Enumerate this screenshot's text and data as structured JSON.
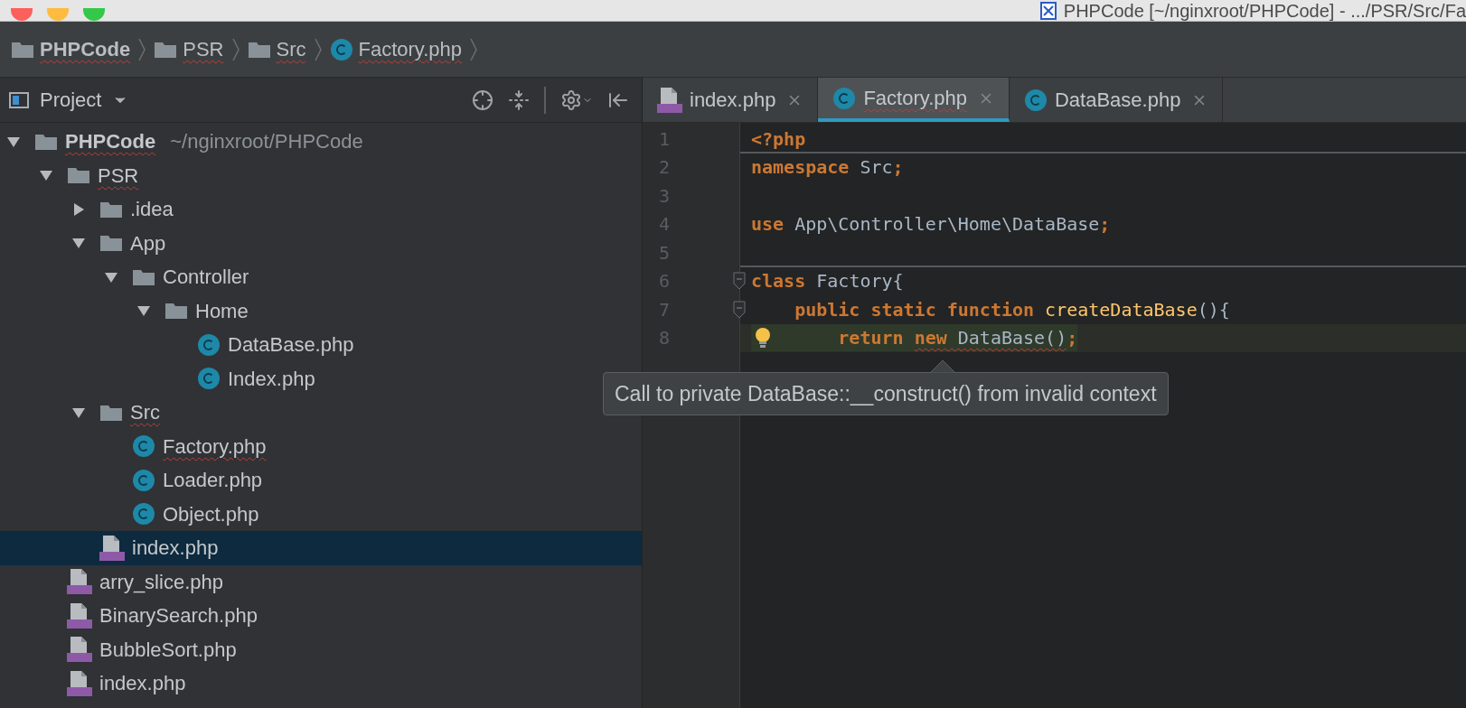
{
  "window": {
    "title": "PHPCode [~/nginxroot/PHPCode] - .../PSR/Src/Fa"
  },
  "breadcrumbs": [
    {
      "label": "PHPCode",
      "kind": "folder",
      "bold": true,
      "misspelled": true
    },
    {
      "label": "PSR",
      "kind": "folder",
      "bold": false,
      "misspelled": true
    },
    {
      "label": "Src",
      "kind": "folder",
      "bold": false,
      "misspelled": true
    },
    {
      "label": "Factory.php",
      "kind": "class",
      "bold": false,
      "misspelled": true
    }
  ],
  "project_panel": {
    "title": "Project",
    "tree": [
      {
        "label": "PHPCode",
        "path": "~/nginxroot/PHPCode",
        "kind": "folder",
        "expanded": true,
        "selected": false,
        "misspelled": true,
        "children": [
          {
            "label": "PSR",
            "kind": "folder",
            "expanded": true,
            "selected": false,
            "misspelled": true,
            "children": [
              {
                "label": ".idea",
                "kind": "folder",
                "expanded": false,
                "selected": false,
                "misspelled": false
              },
              {
                "label": "App",
                "kind": "folder",
                "expanded": true,
                "selected": false,
                "misspelled": false,
                "children": [
                  {
                    "label": "Controller",
                    "kind": "folder",
                    "expanded": true,
                    "selected": false,
                    "misspelled": false,
                    "children": [
                      {
                        "label": "Home",
                        "kind": "folder",
                        "expanded": true,
                        "selected": false,
                        "misspelled": false,
                        "children": [
                          {
                            "label": "DataBase.php",
                            "kind": "class",
                            "selected": false,
                            "misspelled": false
                          },
                          {
                            "label": "Index.php",
                            "kind": "class",
                            "selected": false,
                            "misspelled": false
                          }
                        ]
                      }
                    ]
                  }
                ]
              },
              {
                "label": "Src",
                "kind": "folder",
                "expanded": true,
                "selected": false,
                "misspelled": true,
                "children": [
                  {
                    "label": "Factory.php",
                    "kind": "class",
                    "selected": false,
                    "misspelled": true
                  },
                  {
                    "label": "Loader.php",
                    "kind": "class",
                    "selected": false,
                    "misspelled": false
                  },
                  {
                    "label": "Object.php",
                    "kind": "class",
                    "selected": false,
                    "misspelled": false
                  }
                ]
              },
              {
                "label": "index.php",
                "kind": "php",
                "selected": true,
                "misspelled": false
              }
            ]
          },
          {
            "label": "arry_slice.php",
            "kind": "php",
            "selected": false,
            "misspelled": false
          },
          {
            "label": "BinarySearch.php",
            "kind": "php",
            "selected": false,
            "misspelled": false
          },
          {
            "label": "BubbleSort.php",
            "kind": "php",
            "selected": false,
            "misspelled": false
          },
          {
            "label": "index.php",
            "kind": "php",
            "selected": false,
            "misspelled": false
          }
        ]
      }
    ]
  },
  "tabs": [
    {
      "label": "index.php",
      "kind": "php",
      "selected": false,
      "misspelled": false
    },
    {
      "label": "Factory.php",
      "kind": "class",
      "selected": true,
      "misspelled": true
    },
    {
      "label": "DataBase.php",
      "kind": "class",
      "selected": false,
      "misspelled": false
    }
  ],
  "editor": {
    "lines": [
      {
        "number": "1",
        "current": false,
        "fold": false,
        "bulb": false,
        "separator_below": true,
        "tokens": [
          {
            "text": "<?php",
            "kind": "keyword",
            "error": false
          }
        ]
      },
      {
        "number": "2",
        "current": false,
        "fold": false,
        "bulb": false,
        "separator_below": false,
        "tokens": [
          {
            "text": "namespace",
            "kind": "keyword",
            "error": false
          },
          {
            "text": " Src",
            "kind": "plain",
            "error": false
          },
          {
            "text": ";",
            "kind": "keyword",
            "error": false
          }
        ]
      },
      {
        "number": "3",
        "current": false,
        "fold": false,
        "bulb": false,
        "separator_below": false
      },
      {
        "number": "4",
        "current": false,
        "fold": false,
        "bulb": false,
        "separator_below": false,
        "tokens": [
          {
            "text": "use",
            "kind": "keyword",
            "error": false
          },
          {
            "text": " App\\Controller\\Home\\DataBase",
            "kind": "plain",
            "error": false
          },
          {
            "text": ";",
            "kind": "keyword",
            "error": false
          }
        ]
      },
      {
        "number": "5",
        "current": false,
        "fold": false,
        "bulb": false,
        "separator_below": true
      },
      {
        "number": "6",
        "current": false,
        "fold": true,
        "bulb": false,
        "separator_below": false,
        "tokens": [
          {
            "text": "class",
            "kind": "keyword",
            "error": false
          },
          {
            "text": " Factory{",
            "kind": "plain",
            "error": false
          }
        ]
      },
      {
        "number": "7",
        "current": false,
        "fold": true,
        "bulb": false,
        "separator_below": false,
        "tokens": [
          {
            "text": "    public static function",
            "kind": "keyword",
            "error": false
          },
          {
            "text": " createDataBase",
            "kind": "method",
            "error": false
          },
          {
            "text": "(){",
            "kind": "plain",
            "error": false
          }
        ]
      },
      {
        "number": "8",
        "current": true,
        "fold": false,
        "bulb": true,
        "separator_below": false,
        "tokens": [
          {
            "text": "        return ",
            "kind": "keyword",
            "error": false
          },
          {
            "text": "new",
            "kind": "keyword",
            "error": true
          },
          {
            "text": " DataBase()",
            "kind": "plain",
            "error": true
          },
          {
            "text": ";",
            "kind": "keyword",
            "error": false
          }
        ]
      }
    ],
    "tooltip": "Call to private DataBase::__construct() from invalid context"
  }
}
